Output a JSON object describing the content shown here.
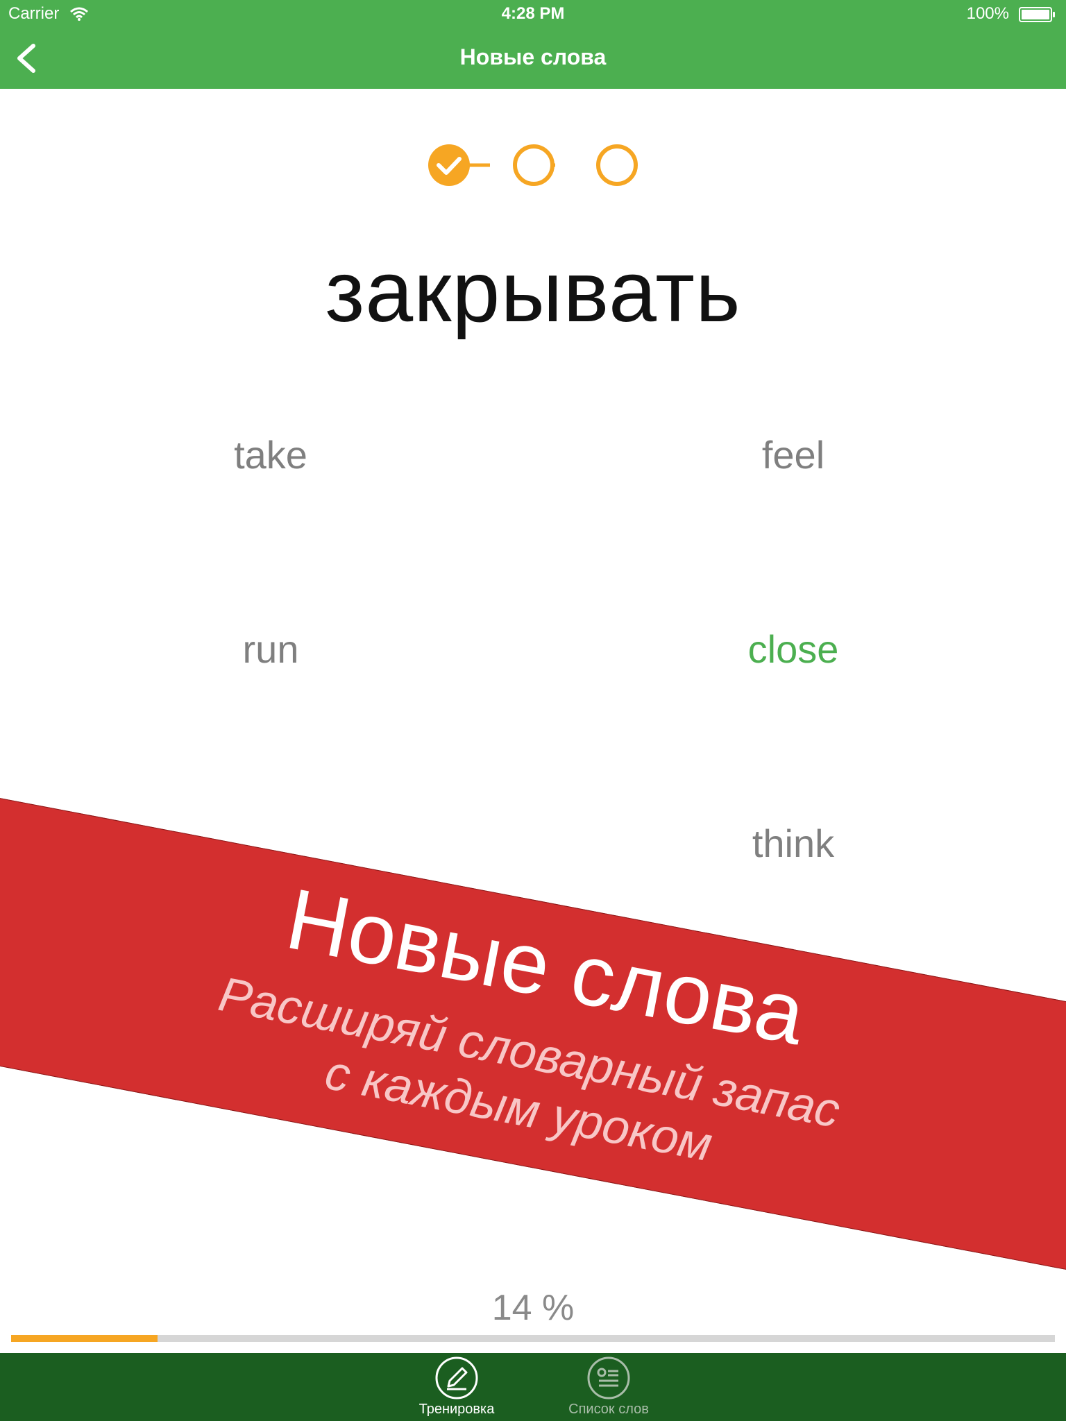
{
  "status": {
    "carrier": "Carrier",
    "time": "4:28 PM",
    "battery": "100%"
  },
  "nav": {
    "title": "Новые слова"
  },
  "quiz": {
    "steps_completed": 1,
    "steps_total": 3,
    "word": "закрывать",
    "options": [
      {
        "label": "take",
        "correct": false
      },
      {
        "label": "feel",
        "correct": false
      },
      {
        "label": "run",
        "correct": false
      },
      {
        "label": "close",
        "correct": true
      },
      {
        "label": "",
        "correct": false
      },
      {
        "label": "think",
        "correct": false
      }
    ]
  },
  "banner": {
    "title": "Новые слова",
    "subtitle_line1": "Расширяй словарный запас",
    "subtitle_line2": "с каждым уроком"
  },
  "progress": {
    "label": "14 %",
    "fraction": 0.14
  },
  "tabs": [
    {
      "label": "Тренировка",
      "icon": "pencil-icon",
      "active": true
    },
    {
      "label": "Список слов",
      "icon": "word-list-icon",
      "active": false
    }
  ],
  "colors": {
    "brand": "#4caf50",
    "tabbar": "#1b5e20",
    "accent": "#f6a623",
    "banner": "#d32f2f",
    "correct": "#4caf50"
  }
}
